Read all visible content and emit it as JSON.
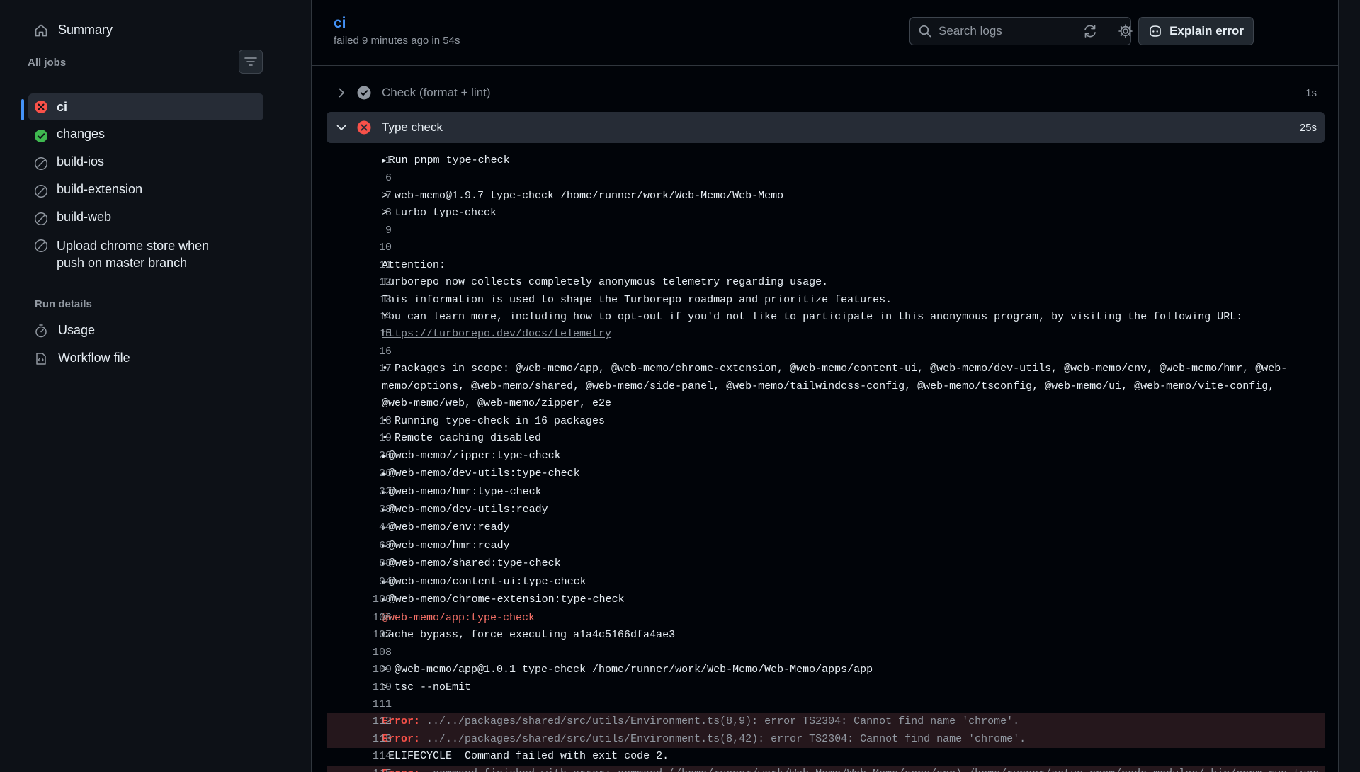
{
  "sidebar": {
    "summary_label": "Summary",
    "all_jobs_label": "All jobs",
    "jobs": [
      {
        "label": "ci",
        "status": "failed"
      },
      {
        "label": "changes",
        "status": "success"
      },
      {
        "label": "build-ios",
        "status": "skipped"
      },
      {
        "label": "build-extension",
        "status": "skipped"
      },
      {
        "label": "build-web",
        "status": "skipped"
      },
      {
        "label": "Upload chrome store when push on master branch",
        "status": "skipped"
      }
    ],
    "run_details_label": "Run details",
    "run_details": [
      {
        "label": "Usage",
        "icon": "stopwatch-icon"
      },
      {
        "label": "Workflow file",
        "icon": "workflow-file-icon"
      }
    ]
  },
  "header": {
    "job_title": "ci",
    "job_subtitle": "failed 9 minutes ago in 54s",
    "search_placeholder": "Search logs",
    "explain_label": "Explain error"
  },
  "steps": [
    {
      "label": "Check (format + lint)",
      "duration": "1s",
      "status": "success",
      "expanded": false
    },
    {
      "label": "Type check",
      "duration": "25s",
      "status": "failed",
      "expanded": true
    }
  ],
  "log_lines": [
    {
      "n": "1",
      "text": "Run pnpm type-check",
      "kind": "group"
    },
    {
      "n": "6",
      "text": "",
      "kind": "plain"
    },
    {
      "n": "7",
      "text": "> web-memo@1.9.7 type-check /home/runner/work/Web-Memo/Web-Memo",
      "kind": "plain"
    },
    {
      "n": "8",
      "text": "> turbo type-check",
      "kind": "plain"
    },
    {
      "n": "9",
      "text": "",
      "kind": "plain"
    },
    {
      "n": "10",
      "text": "",
      "kind": "plain"
    },
    {
      "n": "11",
      "text": "Attention:",
      "kind": "plain"
    },
    {
      "n": "12",
      "text": "Turborepo now collects completely anonymous telemetry regarding usage.",
      "kind": "plain"
    },
    {
      "n": "13",
      "text": "This information is used to shape the Turborepo roadmap and prioritize features.",
      "kind": "plain"
    },
    {
      "n": "14",
      "text": "You can learn more, including how to opt-out if you'd not like to participate in this anonymous program, by visiting the following URL:",
      "kind": "plain"
    },
    {
      "n": "15",
      "text": "https://turborepo.dev/docs/telemetry",
      "kind": "link"
    },
    {
      "n": "16",
      "text": "",
      "kind": "plain"
    },
    {
      "n": "17",
      "text": "• Packages in scope: @web-memo/app, @web-memo/chrome-extension, @web-memo/content-ui, @web-memo/dev-utils, @web-memo/env, @web-memo/hmr, @web-memo/options, @web-memo/shared, @web-memo/side-panel, @web-memo/tailwindcss-config, @web-memo/tsconfig, @web-memo/ui, @web-memo/vite-config, @web-memo/web, @web-memo/zipper, e2e",
      "kind": "plain"
    },
    {
      "n": "18",
      "text": "• Running type-check in 16 packages",
      "kind": "plain"
    },
    {
      "n": "19",
      "text": "• Remote caching disabled",
      "kind": "plain"
    },
    {
      "n": "20",
      "text": "@web-memo/zipper:type-check",
      "kind": "group"
    },
    {
      "n": "26",
      "text": "@web-memo/dev-utils:type-check",
      "kind": "group"
    },
    {
      "n": "32",
      "text": "@web-memo/hmr:type-check",
      "kind": "group"
    },
    {
      "n": "38",
      "text": "@web-memo/dev-utils:ready",
      "kind": "group"
    },
    {
      "n": "44",
      "text": "@web-memo/env:ready",
      "kind": "group"
    },
    {
      "n": "68",
      "text": "@web-memo/hmr:ready",
      "kind": "group"
    },
    {
      "n": "88",
      "text": "@web-memo/shared:type-check",
      "kind": "group"
    },
    {
      "n": "94",
      "text": "@web-memo/content-ui:type-check",
      "kind": "group"
    },
    {
      "n": "100",
      "text": "@web-memo/chrome-extension:type-check",
      "kind": "group"
    },
    {
      "n": "106",
      "text": "@web-memo/app:type-check",
      "kind": "red"
    },
    {
      "n": "107",
      "text": "cache bypass, force executing a1a4c5166dfa4ae3",
      "kind": "plain"
    },
    {
      "n": "108",
      "text": "",
      "kind": "plain"
    },
    {
      "n": "109",
      "text": "> @web-memo/app@1.0.1 type-check /home/runner/work/Web-Memo/Web-Memo/apps/app",
      "kind": "plain"
    },
    {
      "n": "110",
      "text": "> tsc --noEmit",
      "kind": "plain"
    },
    {
      "n": "111",
      "text": "",
      "kind": "plain"
    },
    {
      "n": "112",
      "label": "Error:",
      "text": " ../../packages/shared/src/utils/Environment.ts(8,9): error TS2304: Cannot find name 'chrome'.",
      "kind": "error"
    },
    {
      "n": "113",
      "label": "Error:",
      "text": " ../../packages/shared/src/utils/Environment.ts(8,42): error TS2304: Cannot find name 'chrome'.",
      "kind": "error"
    },
    {
      "n": "114",
      "text": " ELIFECYCLE  Command failed with exit code 2.",
      "kind": "plain"
    },
    {
      "n": "115",
      "label": "Error:",
      "text": "  command finished with error: command (/home/runner/work/Web-Memo/Web-Memo/apps/app) /home/runner/setup-pnpm/node_modules/.bin/pnpm run type-",
      "kind": "error"
    }
  ],
  "colors": {
    "accent": "#4493f8",
    "error": "#f85149",
    "success": "#3fb950",
    "muted": "#9198a1"
  }
}
